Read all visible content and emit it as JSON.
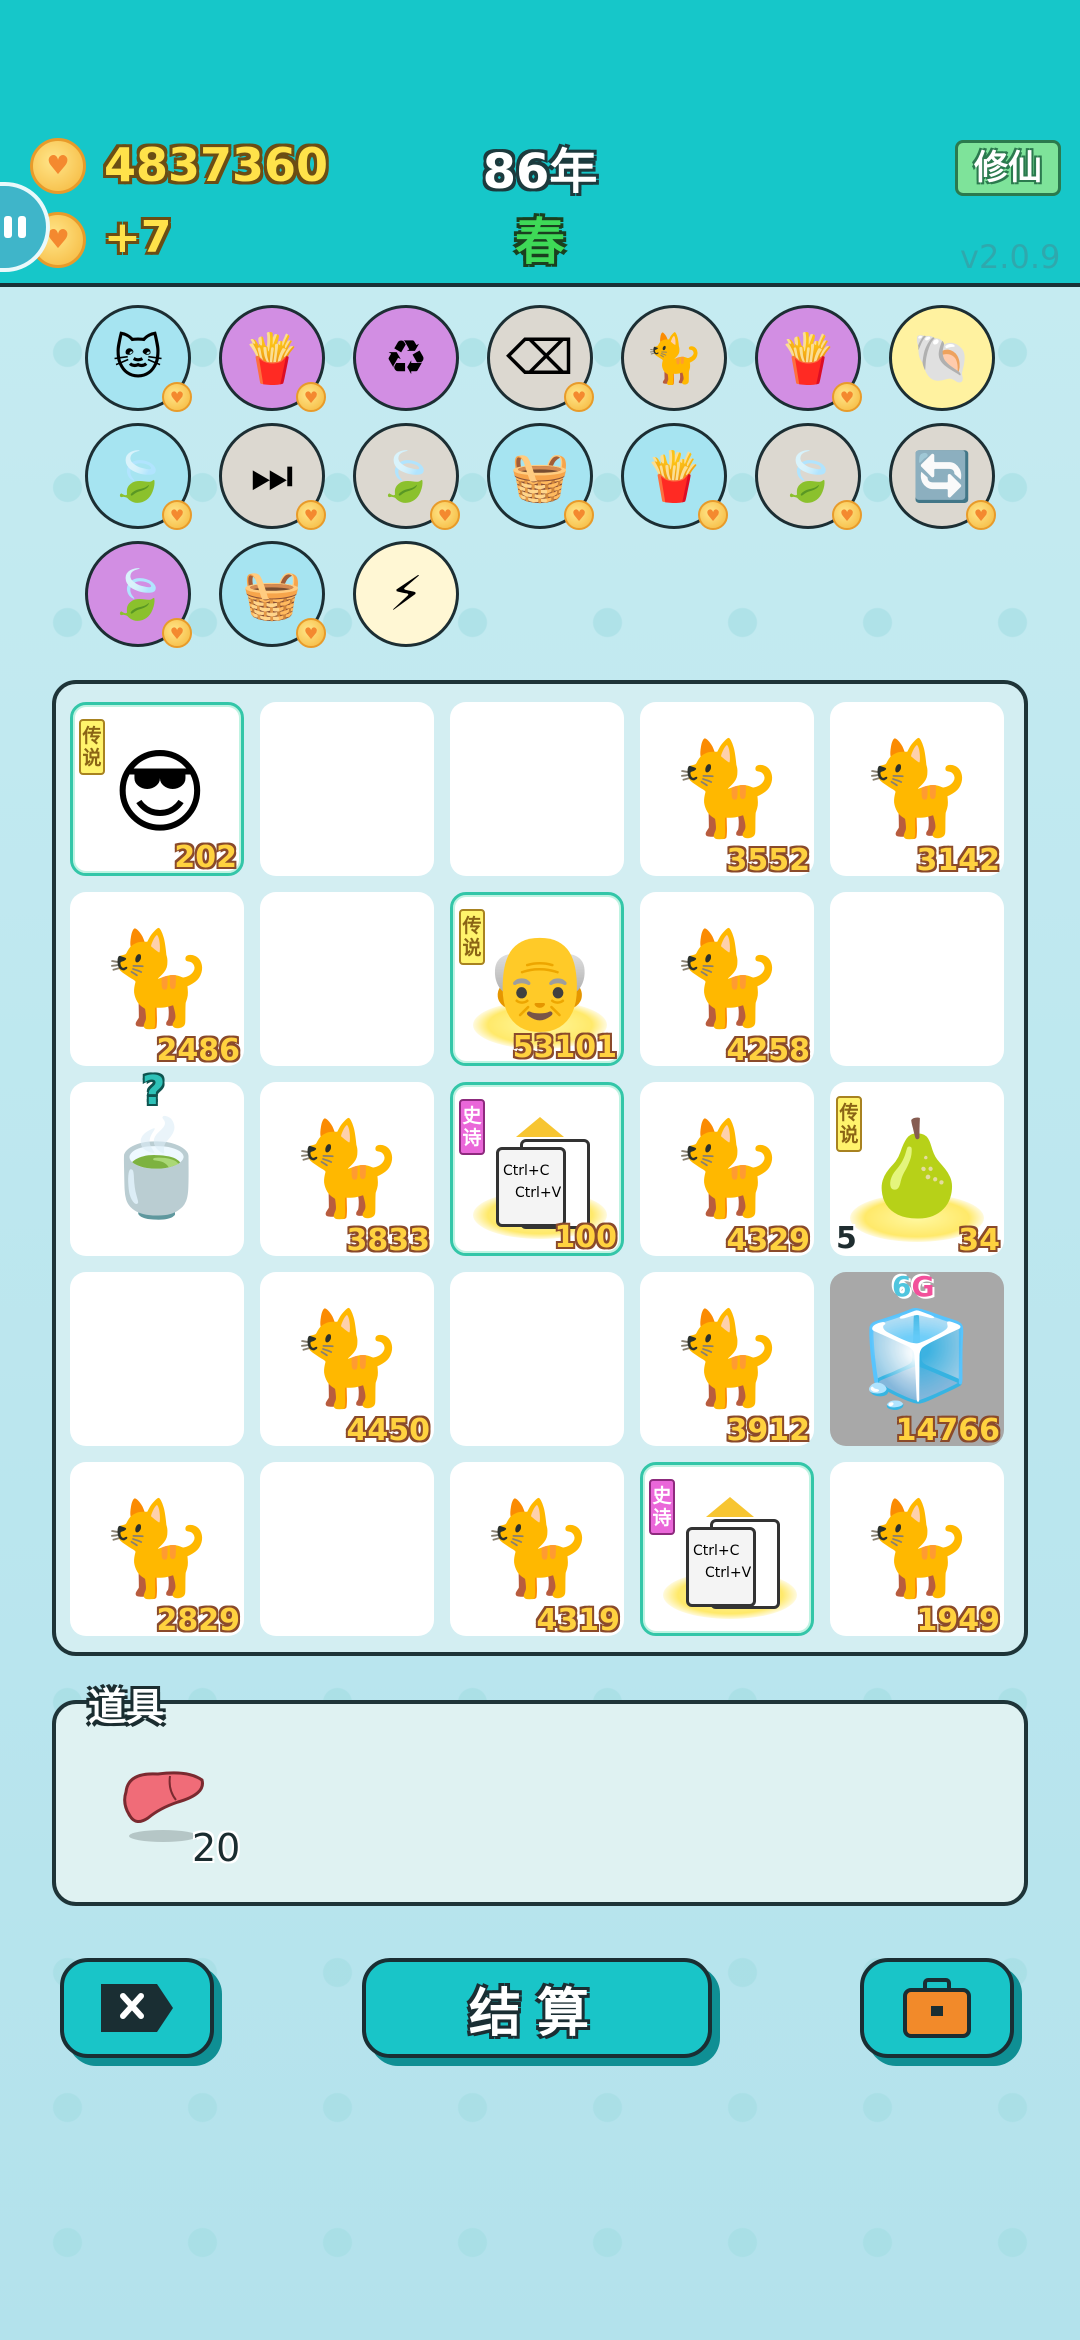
{
  "header": {
    "coins": "4837360",
    "income": "+7",
    "year": "86年",
    "season": "春",
    "cultivate_label": "修仙",
    "version": "v2.0.9"
  },
  "skills": [
    {
      "icon": "cat-skill-icon",
      "glyph": "🐱",
      "bg": "blue",
      "badge": true
    },
    {
      "icon": "fries-icon",
      "glyph": "🍟",
      "bg": "purple",
      "badge": true
    },
    {
      "icon": "recycle-icon",
      "glyph": "♻",
      "bg": "purple",
      "badge": false
    },
    {
      "icon": "delete-tag-icon",
      "glyph": "⌫",
      "bg": "gray",
      "badge": true
    },
    {
      "icon": "twin-cats-icon",
      "glyph": "🐈",
      "bg": "gray",
      "badge": false
    },
    {
      "icon": "fries-icon",
      "glyph": "🍟",
      "bg": "purple",
      "badge": true
    },
    {
      "icon": "shell-icon",
      "glyph": "🐚",
      "bg": "yellow",
      "badge": false
    },
    {
      "icon": "leaf-icon",
      "glyph": "🍃",
      "bg": "blue",
      "badge": true
    },
    {
      "icon": "skip-icon",
      "glyph": "⏭",
      "bg": "gray",
      "badge": true
    },
    {
      "icon": "leaf-icon",
      "glyph": "🍃",
      "bg": "gray",
      "badge": true
    },
    {
      "icon": "fruit-basket-icon",
      "glyph": "🧺",
      "bg": "blue",
      "badge": true
    },
    {
      "icon": "fries-icon",
      "glyph": "🍟",
      "bg": "blue",
      "badge": true
    },
    {
      "icon": "leaf-icon",
      "glyph": "🍃",
      "bg": "gray",
      "badge": true
    },
    {
      "icon": "refresh-icon",
      "glyph": "🔄",
      "bg": "gray",
      "badge": true
    },
    {
      "icon": "leaf-icon",
      "glyph": "🍃",
      "bg": "purple",
      "badge": true
    },
    {
      "icon": "fruit-basket-icon",
      "glyph": "🧺",
      "bg": "blue",
      "badge": true
    },
    {
      "icon": "lightning-icon",
      "glyph": "⚡",
      "bg": "cream",
      "badge": false
    }
  ],
  "board": [
    {
      "kind": "person-sunglasses",
      "icon": "man-sunglasses-icon",
      "glyph": "😎",
      "tag": "传说",
      "tag_type": "legend",
      "value": "202",
      "special": true
    },
    {
      "kind": "empty"
    },
    {
      "kind": "empty"
    },
    {
      "kind": "cat",
      "icon": "cat-icon",
      "glyph": "🐈",
      "value": "3552"
    },
    {
      "kind": "cat",
      "icon": "cat-icon",
      "glyph": "🐈",
      "value": "3142"
    },
    {
      "kind": "cat",
      "icon": "cat-icon",
      "glyph": "🐈",
      "value": "2486"
    },
    {
      "kind": "empty"
    },
    {
      "kind": "old-man-crown",
      "icon": "crowned-elder-icon",
      "glyph": "👴",
      "tag": "传说",
      "tag_type": "legend",
      "value": "53101",
      "special": true,
      "glow": true
    },
    {
      "kind": "cat",
      "icon": "cat-icon",
      "glyph": "🐈",
      "value": "4258"
    },
    {
      "kind": "empty"
    },
    {
      "kind": "tea-bowl",
      "icon": "tea-bowl-icon",
      "glyph": "🍵",
      "question": "?"
    },
    {
      "kind": "cat",
      "icon": "cat-icon",
      "glyph": "🐈",
      "value": "3833"
    },
    {
      "kind": "copy-paste",
      "icon": "copy-paste-icon",
      "glyph": "📋",
      "tag": "史诗",
      "tag_type": "epic",
      "value": "100",
      "special": true,
      "glow": true
    },
    {
      "kind": "cat",
      "icon": "cat-icon",
      "glyph": "🐈",
      "value": "4329"
    },
    {
      "kind": "pear-crown",
      "icon": "crowned-pear-icon",
      "glyph": "🍐",
      "tag": "传说",
      "tag_type": "legend",
      "value": "34",
      "level": "5",
      "glow": true
    },
    {
      "kind": "empty"
    },
    {
      "kind": "cat",
      "icon": "cat-icon",
      "glyph": "🐈",
      "value": "4450"
    },
    {
      "kind": "empty"
    },
    {
      "kind": "cat",
      "icon": "cat-icon",
      "glyph": "🐈",
      "value": "3912"
    },
    {
      "kind": "fridge",
      "icon": "fridge-icon",
      "glyph": "🧊",
      "value": "14766",
      "six": "6",
      "g": "G",
      "gray": true
    },
    {
      "kind": "cat",
      "icon": "cat-icon",
      "glyph": "🐈",
      "value": "2829"
    },
    {
      "kind": "empty"
    },
    {
      "kind": "cat",
      "icon": "cat-icon",
      "glyph": "🐈",
      "value": "4319"
    },
    {
      "kind": "copy-paste",
      "icon": "copy-paste-icon",
      "glyph": "📋",
      "tag": "史诗",
      "tag_type": "epic",
      "special": true,
      "glow": true
    },
    {
      "kind": "cat",
      "icon": "cat-icon",
      "glyph": "🐈",
      "value": "1949"
    }
  ],
  "copy_text": {
    "line1": "Ctrl+C",
    "line2": "Ctrl+V"
  },
  "props": {
    "title": "道具",
    "item_icon": "liver-icon",
    "item_count": "20"
  },
  "buttons": {
    "delete_icon": "delete-tag-icon",
    "settle_label": "结算",
    "bag_icon": "briefcase-icon"
  },
  "colors": {
    "header_bg": "#16c7c9",
    "coin_text": "#ffe24a",
    "season_green": "#3ed957",
    "board_border": "#1e3438"
  }
}
